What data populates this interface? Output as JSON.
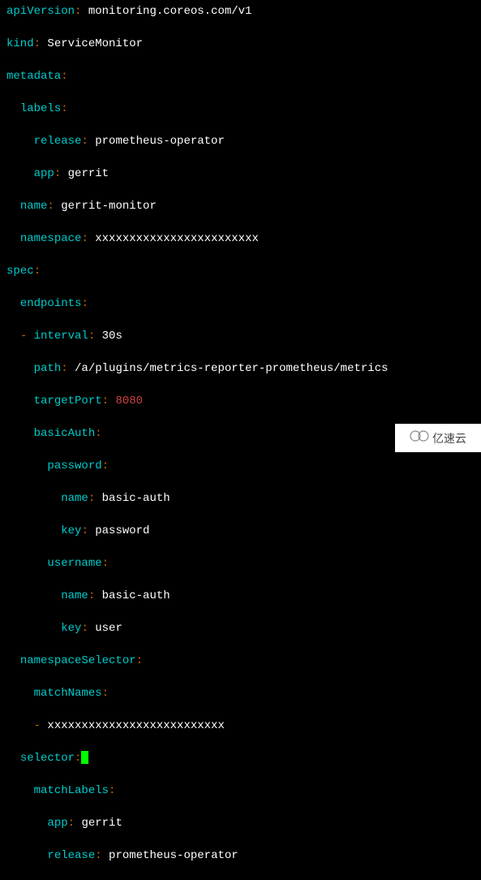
{
  "yaml": {
    "apiVersion": {
      "k": "apiVersion",
      "v": "monitoring.coreos.com/v1"
    },
    "kind": {
      "k": "kind",
      "v": "ServiceMonitor"
    },
    "metadata": {
      "k": "metadata"
    },
    "labels": {
      "k": "labels"
    },
    "labels_release": {
      "k": "release",
      "v": "prometheus-operator"
    },
    "labels_app": {
      "k": "app",
      "v": "gerrit"
    },
    "name": {
      "k": "name",
      "v": "gerrit-monitor"
    },
    "namespace": {
      "k": "namespace",
      "v": "xxxxxxxxxxxxxxxxxxxxxxxx"
    },
    "spec": {
      "k": "spec"
    },
    "endpoints": {
      "k": "endpoints"
    },
    "interval": {
      "k": "interval",
      "v": "30s"
    },
    "path": {
      "k": "path",
      "v": "/a/plugins/metrics-reporter-prometheus/metrics"
    },
    "targetPort": {
      "k": "targetPort",
      "v": "8080"
    },
    "basicAuth": {
      "k": "basicAuth"
    },
    "password": {
      "k": "password"
    },
    "pw_name": {
      "k": "name",
      "v": "basic-auth"
    },
    "pw_key": {
      "k": "key",
      "v": "password"
    },
    "username": {
      "k": "username"
    },
    "un_name": {
      "k": "name",
      "v": "basic-auth"
    },
    "un_key": {
      "k": "key",
      "v": "user"
    },
    "namespaceSelector": {
      "k": "namespaceSelector"
    },
    "matchNames": {
      "k": "matchNames"
    },
    "matchNames_item": {
      "v": "xxxxxxxxxxxxxxxxxxxxxxxxxx"
    },
    "selector": {
      "k": "selector"
    },
    "matchLabels": {
      "k": "matchLabels"
    },
    "ml_app": {
      "k": "app",
      "v": "gerrit"
    },
    "ml_release": {
      "k": "release",
      "v": "prometheus-operator"
    }
  },
  "colon": ":",
  "dash": "-",
  "watermark": {
    "text": "亿速云"
  }
}
